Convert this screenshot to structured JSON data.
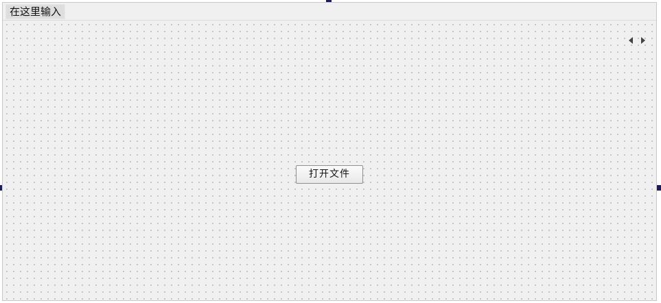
{
  "menubar": {
    "placeholder_item": "在这里输入"
  },
  "tab_scroller": {
    "left_icon": "arrow-left-icon",
    "right_icon": "arrow-right-icon"
  },
  "main": {
    "open_file_button_label": "打开文件"
  },
  "colors": {
    "form_background": "#f0f0f0",
    "grid_dot": "#8a8a8a",
    "selection_handle": "#1c1c5a"
  }
}
